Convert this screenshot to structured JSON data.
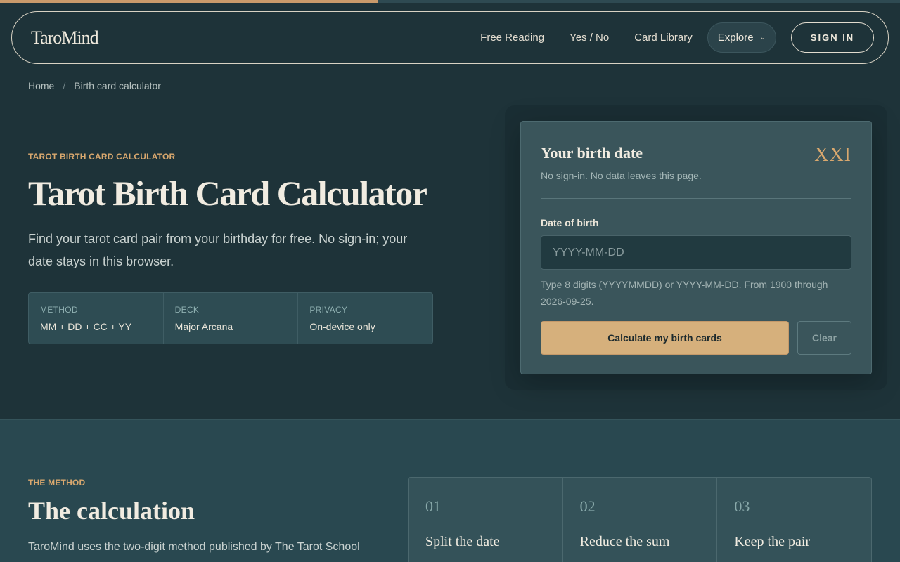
{
  "progress": {
    "fraction": 0.42,
    "color": "#c99a6b"
  },
  "nav": {
    "logo": "TaroMind",
    "links": [
      "Free Reading",
      "Yes / No",
      "Card Library"
    ],
    "explore_label": "Explore",
    "signin_label": "SIGN IN"
  },
  "breadcrumb": {
    "home": "Home",
    "separator": "/",
    "current": "Birth card calculator"
  },
  "hero": {
    "eyebrow": "TAROT BIRTH CARD CALCULATOR",
    "title": "Tarot Birth Card Calculator",
    "description": "Find your tarot card pair from your birthday for free. No sign-in; your date stays in this browser.",
    "facts": [
      {
        "label": "METHOD",
        "value": "MM + DD + CC + YY"
      },
      {
        "label": "DECK",
        "value": "Major Arcana"
      },
      {
        "label": "PRIVACY",
        "value": "On-device only"
      }
    ]
  },
  "form": {
    "title": "Your birth date",
    "numeral": "XXI",
    "subtitle": "No sign-in. No data leaves this page.",
    "field_label": "Date of birth",
    "input_value": "",
    "input_placeholder": "YYYY-MM-DD",
    "hint": "Type 8 digits (YYYYMMDD) or YYYY-MM-DD. From 1900 through 2026-09-25.",
    "calculate_label": "Calculate my birth cards",
    "clear_label": "Clear"
  },
  "method": {
    "eyebrow": "THE METHOD",
    "title": "The calculation",
    "description": "TaroMind uses the two-digit method published by The Tarot School",
    "steps": [
      {
        "number": "01",
        "title": "Split the date"
      },
      {
        "number": "02",
        "title": "Reduce the sum"
      },
      {
        "number": "03",
        "title": "Keep the pair"
      }
    ]
  },
  "colors": {
    "background": "#1e3339",
    "accent": "#d9a86e",
    "button": "#d6b07c",
    "card": "#3a555b"
  }
}
